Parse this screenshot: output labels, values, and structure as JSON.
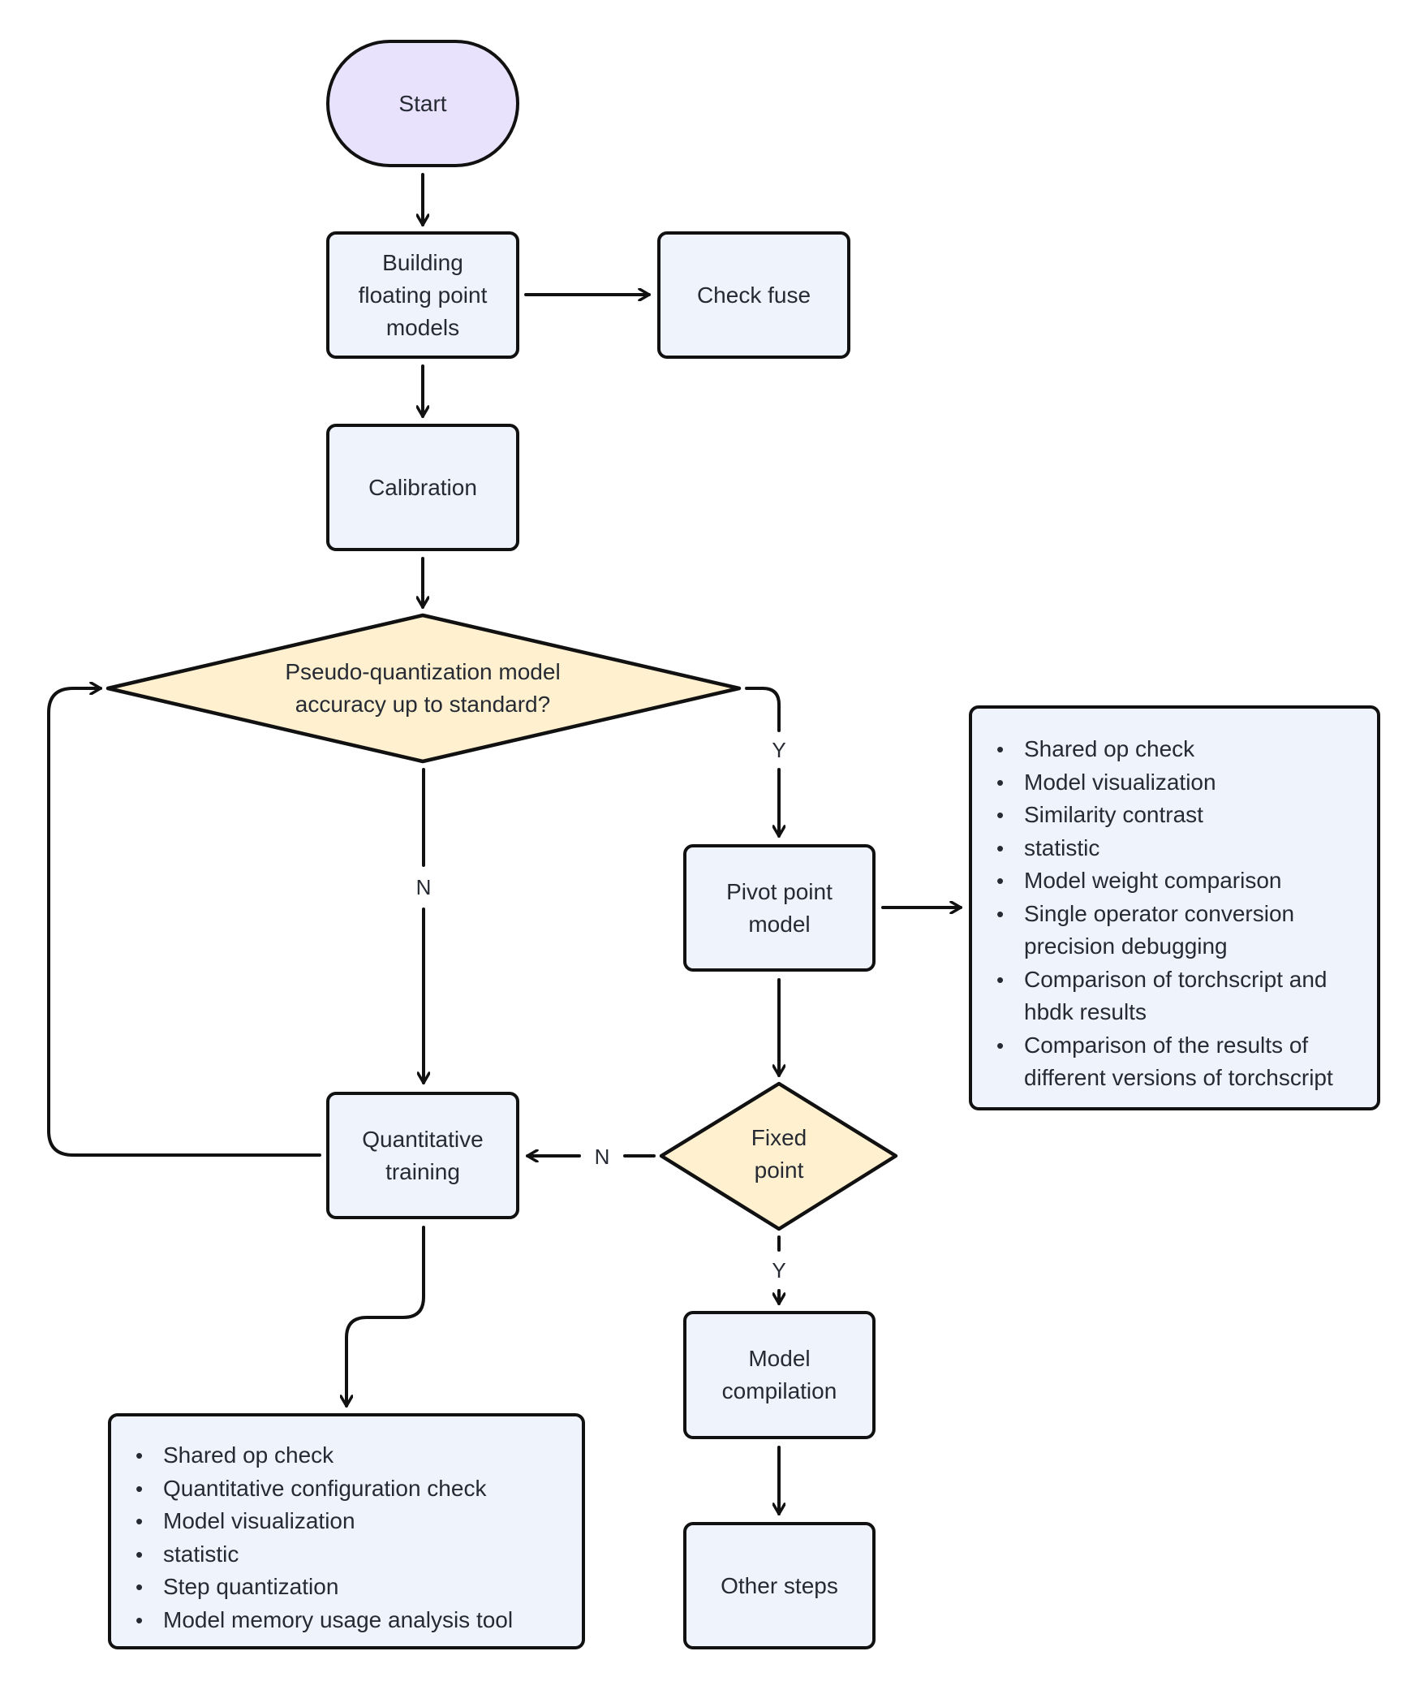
{
  "diagram": {
    "type": "flowchart",
    "colors": {
      "terminal_fill": "#e8e2fc",
      "process_fill": "#eff3fc",
      "decision_fill": "#fff0cf",
      "stroke": "#111111",
      "text": "#262a33"
    },
    "nodes": {
      "start": {
        "label": "Start"
      },
      "build": {
        "label": "Building floating point models",
        "lines": [
          "Building",
          "floating point",
          "models"
        ]
      },
      "check_fuse": {
        "label": "Check fuse"
      },
      "calibration": {
        "label": "Calibration"
      },
      "accuracy_decision": {
        "label": "Pseudo-quantization model accuracy up to standard?",
        "lines": [
          "Pseudo-quantization model",
          "accuracy up to standard?"
        ]
      },
      "pivot": {
        "label": "Pivot point model",
        "lines": [
          "Pivot point",
          "model"
        ]
      },
      "fixed_point_decision": {
        "label": "Fixed point",
        "lines": [
          "Fixed",
          "point"
        ]
      },
      "quant_training": {
        "label": "Quantitative training",
        "lines": [
          "Quantitative",
          "training"
        ]
      },
      "model_compilation": {
        "label": "Model compilation",
        "lines": [
          "Model",
          "compilation"
        ]
      },
      "other_steps": {
        "label": "Other steps"
      }
    },
    "pivot_tools": {
      "items": [
        "Shared op check",
        "Model visualization",
        "Similarity contrast",
        "statistic",
        "Model weight comparison",
        "Single operator conversion precision debugging",
        "Comparison of torchscript and hbdk results",
        "Comparison of the results of different versions of torchscript"
      ]
    },
    "quant_tools": {
      "items": [
        "Shared op check",
        "Quantitative configuration check",
        "Model visualization",
        "statistic",
        "Step quantization",
        "Model memory usage analysis tool"
      ]
    },
    "edge_labels": {
      "accuracy_yes": "Y",
      "accuracy_no": "N",
      "fixed_yes": "Y",
      "fixed_no": "N"
    },
    "edges": [
      {
        "from": "start",
        "to": "build"
      },
      {
        "from": "build",
        "to": "check_fuse"
      },
      {
        "from": "build",
        "to": "calibration"
      },
      {
        "from": "calibration",
        "to": "accuracy_decision"
      },
      {
        "from": "accuracy_decision",
        "to": "pivot",
        "label": "Y"
      },
      {
        "from": "accuracy_decision",
        "to": "quant_training",
        "label": "N"
      },
      {
        "from": "pivot",
        "to": "pivot_tools"
      },
      {
        "from": "pivot",
        "to": "fixed_point_decision"
      },
      {
        "from": "fixed_point_decision",
        "to": "quant_training",
        "label": "N"
      },
      {
        "from": "fixed_point_decision",
        "to": "model_compilation",
        "label": "Y"
      },
      {
        "from": "quant_training",
        "to": "accuracy_decision"
      },
      {
        "from": "quant_training",
        "to": "quant_tools"
      },
      {
        "from": "model_compilation",
        "to": "other_steps"
      }
    ]
  }
}
